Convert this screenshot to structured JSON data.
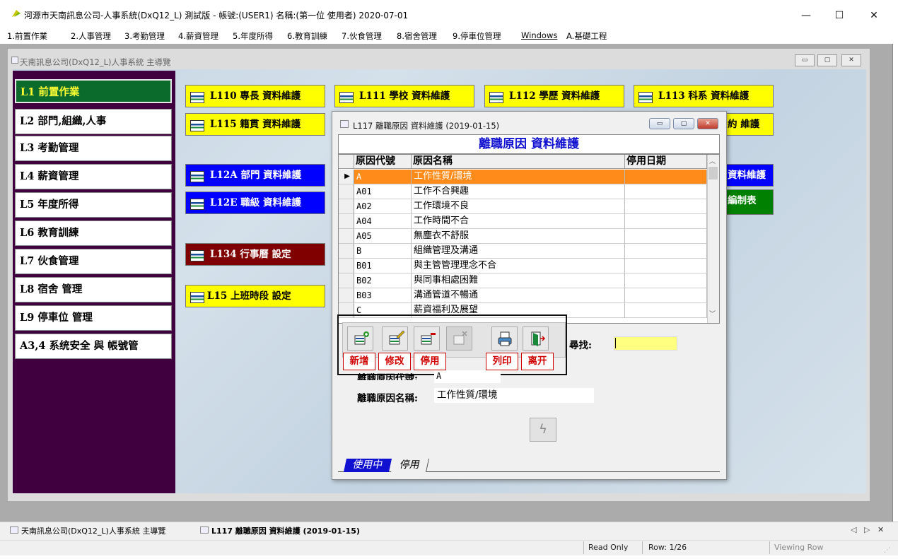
{
  "window": {
    "title": "河源市天南訊息公司-人事系統(DxQ12_L) 測試版 - 帳號:(USER1) 名稱:(第一位 使用者) 2020-07-01",
    "minimize_glyph": "—",
    "maximize_glyph": "☐",
    "close_glyph": "✕"
  },
  "menu": [
    "1.前置作業",
    "2.人事管理",
    "3.考勤管理",
    "4.薪資管理",
    "5.年度所得",
    "6.教育訓練",
    "7.伙食管理",
    "8.宿舍管理",
    "9.停車位管理",
    "Windows",
    "A.基礎工程"
  ],
  "child_window": {
    "title": "天南訊息公司(DxQ12_L)人事系統 主導覽",
    "buttons": [
      "▭",
      "▢",
      "✕"
    ]
  },
  "side_menu": [
    "L1  前置作業",
    "L2  部門,組織,人事",
    "L3  考勤管理",
    "L4  薪資管理",
    "L5  年度所得",
    "L6  教育訓練",
    "L7  伙食管理",
    "L8  宿舍  管理",
    "L9  停車位  管理",
    "A3,4  系统安全  與  帳號管"
  ],
  "main_buttons": {
    "l110": "L110 專長 資料維護",
    "l111": "L111 學校 資料維護",
    "l112": "L112 學歷 資料維護",
    "l113": "L113 科系 資料維護",
    "l115": "L115 籍貫 資料維護",
    "l116_partial": "約 維護",
    "l12a": "L12A 部門 資料維護",
    "l12e": "L12E 職級 資料維護",
    "blue_right_partial": "資料維護",
    "green_right_partial": "編制表",
    "l134": "L134 行事曆 設定",
    "l15": "L15 上班時段 設定"
  },
  "dialog": {
    "title": "L117 離職原因 資料維護 (2019-01-15)",
    "heading": "離職原因 資料維護",
    "columns": [
      "原因代號",
      "原因名稱",
      "停用日期"
    ],
    "rows": [
      {
        "code": "A",
        "name": "工作性質/環境",
        "date": ""
      },
      {
        "code": "A01",
        "name": "工作不合興趣",
        "date": ""
      },
      {
        "code": "A02",
        "name": "工作環境不良",
        "date": ""
      },
      {
        "code": "A04",
        "name": "工作時間不合",
        "date": ""
      },
      {
        "code": "A05",
        "name": "無塵衣不舒服",
        "date": ""
      },
      {
        "code": "B",
        "name": "組織管理及溝通",
        "date": ""
      },
      {
        "code": "B01",
        "name": "與主管管理理念不合",
        "date": ""
      },
      {
        "code": "B02",
        "name": "與同事相處困難",
        "date": ""
      },
      {
        "code": "B03",
        "name": "溝通管道不暢通",
        "date": ""
      },
      {
        "code": "C",
        "name": "薪資福利及展望",
        "date": ""
      }
    ],
    "selected_indicator": "▶",
    "toolbar_labels": [
      "新增",
      "修改",
      "停用",
      "列印",
      "离开"
    ],
    "search_label": "尋找:",
    "search_value": "",
    "code_label": "離職原因代號:",
    "code_value": "A",
    "name_label": "離職原因名稱:",
    "name_value": "工作性質/環境",
    "tabs": [
      "使用中",
      "停用"
    ]
  },
  "taskbar": {
    "item1": "天南訊息公司(DxQ12_L)人事系統 主導覽",
    "item2": "L117 離職原因 資料維護 (2019-01-15)",
    "nav": [
      "◁",
      "▷",
      "✕"
    ]
  },
  "status": {
    "mode": "Read Only",
    "row": "Row: 1/26",
    "view": "Viewing Row"
  },
  "colors": {
    "side_panel": "#400040",
    "active_green": "#0b6b2c",
    "button_yellow": "#ffff00",
    "button_blue": "#0000ff",
    "button_darkred": "#800000",
    "selection_orange": "#ff8c1a",
    "heading_blue": "#1010d0",
    "label_red": "#d00000"
  }
}
